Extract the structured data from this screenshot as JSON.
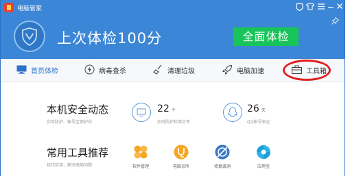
{
  "titlebar": {
    "app_name": "电脑管家",
    "icons": [
      "shield-icon",
      "shirt-icon",
      "menu-icon",
      "minimize-icon",
      "close-icon"
    ]
  },
  "header": {
    "headline": "上次体检100分",
    "scan_button": "全面体检",
    "pin_icon": "pin-icon"
  },
  "nav": {
    "items": [
      {
        "label": "首页体检",
        "icon": "monitor-icon"
      },
      {
        "label": "病毒查杀",
        "icon": "lightning-icon"
      },
      {
        "label": "清理垃圾",
        "icon": "broom-icon"
      },
      {
        "label": "电脑加速",
        "icon": "rocket-icon"
      },
      {
        "label": "工具箱",
        "icon": "toolbox-icon"
      }
    ]
  },
  "security": {
    "title": "本机安全动态",
    "subtitle": "实时防护、帐号宝保护中",
    "stats": [
      {
        "value": "22",
        "unit": "个",
        "label": "实时防护检测文件",
        "icon": "monitor-icon"
      },
      {
        "value": "26",
        "unit": "天",
        "label": "QQ帐号安全",
        "icon": "qq-penguin-icon"
      }
    ]
  },
  "tools": {
    "title": "常用工具推荐",
    "subtitle": "轻巧实用，解决电脑问题",
    "items": [
      {
        "label": "软件管理",
        "icon": "software-manager-icon"
      },
      {
        "label": "电脑诊所",
        "icon": "clinic-icon"
      },
      {
        "label": "修复漏洞",
        "icon": "patch-icon"
      },
      {
        "label": "应用宝",
        "icon": "app-store-icon"
      }
    ]
  },
  "colors": {
    "header_blue": "#3b86d6",
    "scan_green": "#18c45a",
    "annotation_red": "#e02020"
  }
}
